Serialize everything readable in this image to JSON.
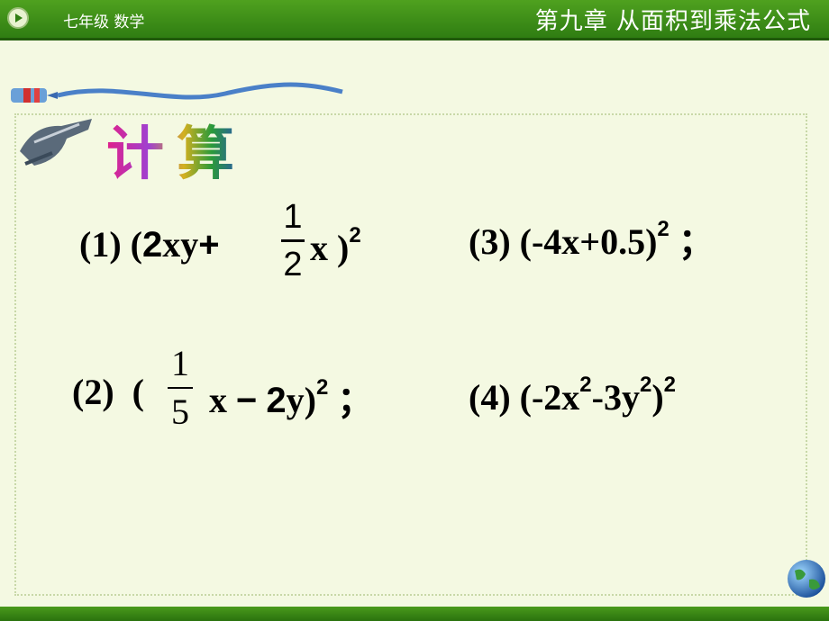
{
  "header": {
    "grade_label": "七年级  数学",
    "chapter_title": "第九章   从面积到乘法公式"
  },
  "heading": "计算",
  "problems": {
    "p1": {
      "label": "(1)",
      "open": "(",
      "coef": "2",
      "term": "xy",
      "plus": "+",
      "frac_num": "1",
      "frac_den": "2",
      "var": "x",
      "close": ")",
      "exp": "2"
    },
    "p2": {
      "label": "(2)",
      "open": "(",
      "frac_num": "1",
      "frac_den": "5",
      "var": "x",
      "minus": "−",
      "coef": "2",
      "term": "y)",
      "exp": "2",
      "end": "；"
    },
    "p3": {
      "label": "(3)",
      "expr": "(-4x+0.5)",
      "exp": "2",
      "end": "；"
    },
    "p4": {
      "label": "(4)",
      "expr_a": "(-2x",
      "exp_a": "2",
      "expr_b": "-3y",
      "exp_b": "2",
      "expr_c": ")",
      "exp_c": "2"
    }
  },
  "icons": [
    "play-icon",
    "pen-icon",
    "writing-hand-icon",
    "globe-icon"
  ],
  "colors": {
    "header_green": "#3f8f18",
    "background": "#f4f9e2"
  }
}
